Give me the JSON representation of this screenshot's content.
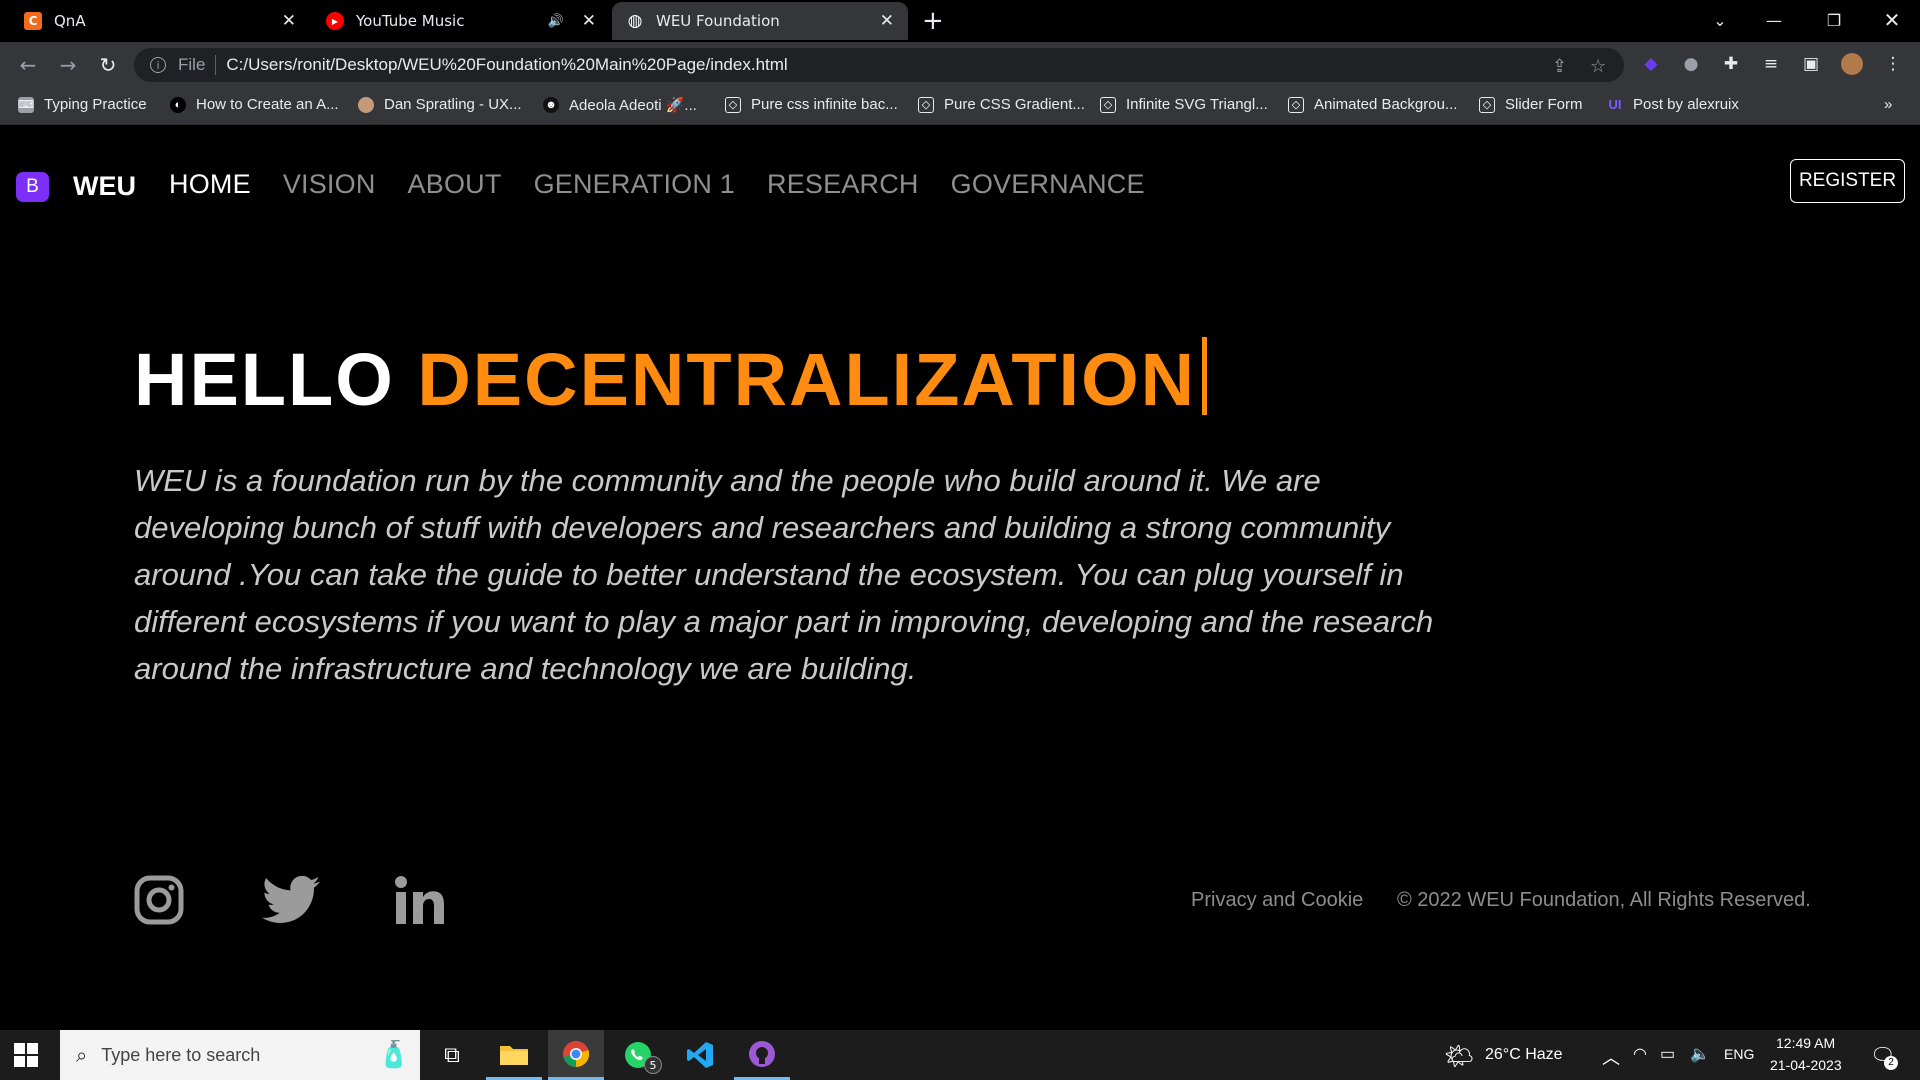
{
  "browser": {
    "tabs": [
      {
        "title": "QnA",
        "icon": "qna-c-icon",
        "icon_color": "#f26b1d",
        "icon_letter": "C"
      },
      {
        "title": "YouTube Music",
        "icon": "youtube-music-icon",
        "icon_color": "#ff0000",
        "icon_letter": "▶",
        "audio": "🔊"
      },
      {
        "title": "WEU Foundation",
        "icon": "globe-icon",
        "icon_color": "#35363a",
        "icon_letter": "◍"
      }
    ],
    "address": {
      "scheme": "File",
      "url": "C:/Users/ronit/Desktop/WEU%20Foundation%20Main%20Page/index.html"
    },
    "bookmarks": [
      {
        "label": "Typing Practice",
        "icon": "keyboard-icon"
      },
      {
        "label": "How to Create an A...",
        "icon": "github-icon"
      },
      {
        "label": "Dan Spratling - UX...",
        "icon": "avatar-icon"
      },
      {
        "label": "Adeola Adeoti 🚀...",
        "icon": "avatar-icon"
      },
      {
        "label": "Pure css infinite bac...",
        "icon": "codepen-icon"
      },
      {
        "label": "Pure CSS Gradient...",
        "icon": "codepen-icon"
      },
      {
        "label": "Infinite SVG Triangl...",
        "icon": "codepen-icon"
      },
      {
        "label": "Animated Backgrou...",
        "icon": "codepen-icon"
      },
      {
        "label": "Slider Form",
        "icon": "codepen-icon"
      },
      {
        "label": "Post by alexruix",
        "icon": "uiverse-icon"
      }
    ],
    "bookmarks_overflow": "»"
  },
  "site": {
    "brand_letter": "B",
    "brand_name": "WEU",
    "nav": [
      "HOME",
      "VISION",
      "ABOUT",
      "GENERATION 1",
      "RESEARCH",
      "GOVERNANCE"
    ],
    "register": "REGISTER",
    "hero": {
      "title_white": "HELLO",
      "title_accent": "DECENTRALIZATION",
      "paragraph": "WEU is a foundation run by the community and the people who build around it. We are developing bunch of stuff with developers and researchers and building a strong community around .You can take the guide to better understand the ecosystem. You can plug yourself in different ecosystems if you want to play a major part in improving, developing and the research around the infrastructure and technology we are building."
    },
    "footer": {
      "social": [
        "instagram-icon",
        "twitter-icon",
        "linkedin-icon"
      ],
      "privacy": "Privacy and Cookie",
      "copyright": "© 2022 WEU Foundation, All Rights Reserved."
    },
    "accent_color": "#ff8c10",
    "brand_color": "#7b2ff7"
  },
  "taskbar": {
    "search_placeholder": "Type here to search",
    "whatsapp_badge": "5",
    "weather": "26°C  Haze",
    "language": "ENG",
    "time": "12:49 AM",
    "date": "21-04-2023",
    "notifications": "2"
  }
}
